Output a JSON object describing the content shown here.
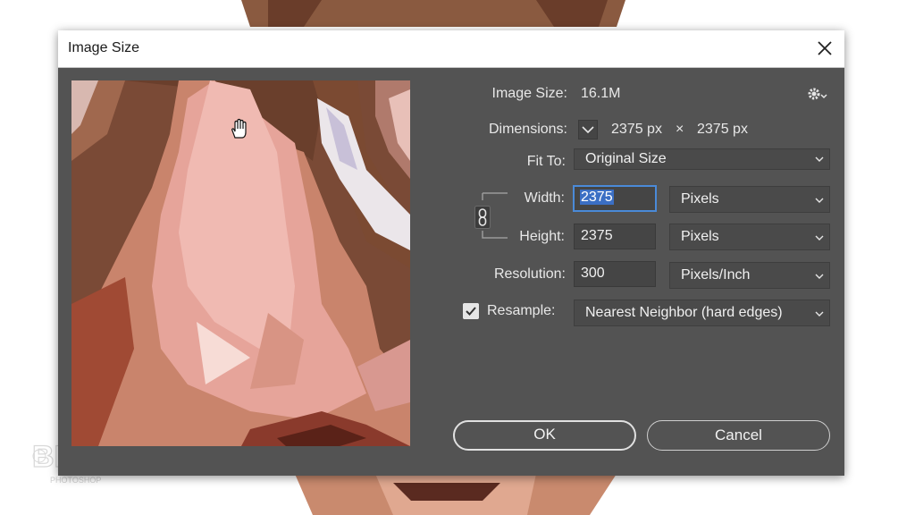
{
  "dialog": {
    "title": "Image Size"
  },
  "info": {
    "image_size_label": "Image Size:",
    "image_size_value": "16.1M",
    "dimensions_label": "Dimensions:",
    "dimensions_width": "2375 px",
    "dimensions_times": "×",
    "dimensions_height": "2375 px",
    "fit_to_label": "Fit To:",
    "fit_to_value": "Original Size"
  },
  "fields": {
    "width_label": "Width:",
    "width_value": "2375",
    "width_unit": "Pixels",
    "height_label": "Height:",
    "height_value": "2375",
    "height_unit": "Pixels",
    "resolution_label": "Resolution:",
    "resolution_value": "300",
    "resolution_unit": "Pixels/Inch",
    "resample_label": "Resample:",
    "resample_checked": true,
    "resample_value": "Nearest Neighbor (hard edges)"
  },
  "buttons": {
    "ok": "OK",
    "cancel": "Cancel"
  },
  "icons": {
    "close": "close-icon",
    "settings": "gear-icon",
    "link": "chain-link-icon",
    "hand": "hand-icon",
    "chevron": "chevron-down-icon"
  },
  "colors": {
    "dialog_bg": "#535353",
    "field_bg": "#454545",
    "focus_border": "#4a8ad8",
    "selection": "#3b6fc4"
  },
  "watermark": {
    "logo": "BLTV",
    "sub": "PHOTOSHOP"
  }
}
